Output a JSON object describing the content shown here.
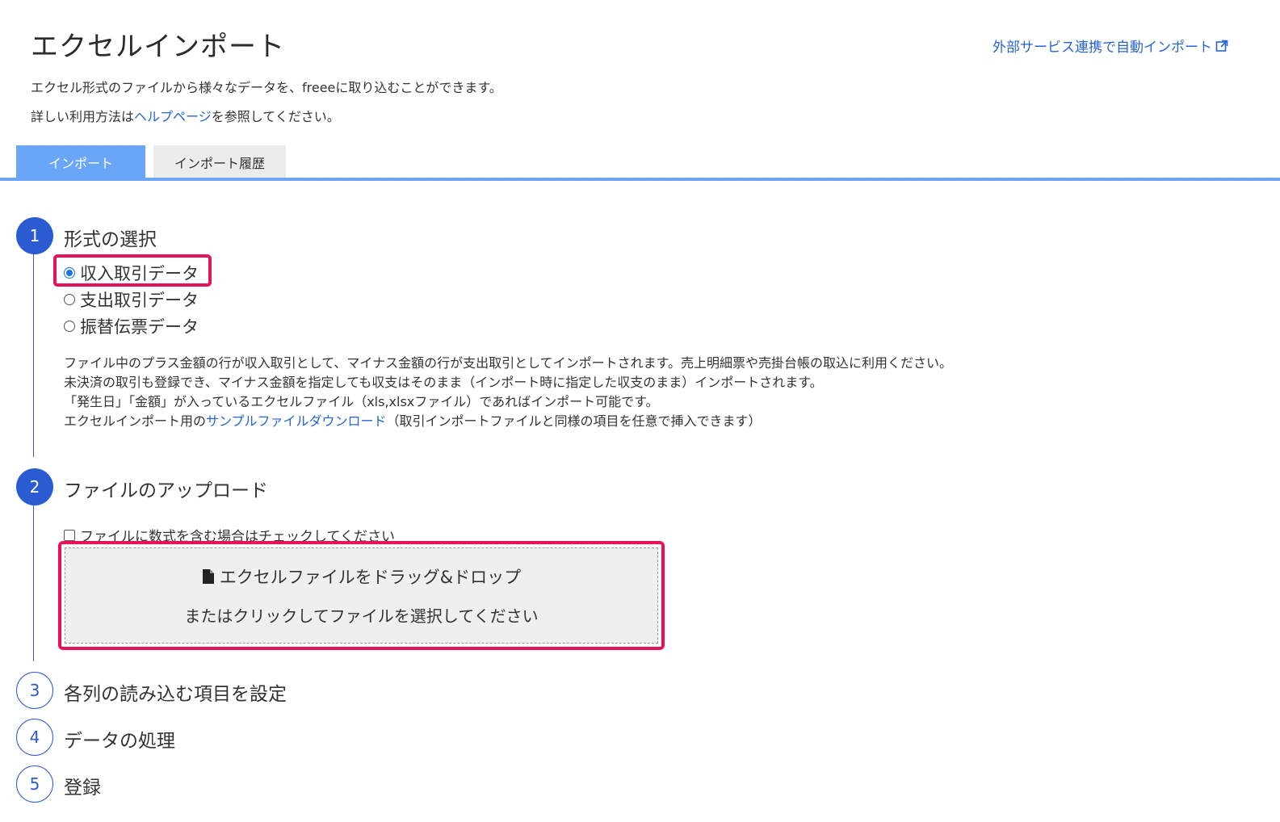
{
  "header": {
    "title": "エクセルインポート",
    "external_link": "外部サービス連携で自動インポート",
    "description_line1": "エクセル形式のファイルから様々なデータを、freeeに取り込むことができます。",
    "description_line2_prefix": "詳しい利用方法は",
    "description_line2_link": "ヘルプページ",
    "description_line2_suffix": "を参照してください。"
  },
  "tabs": [
    {
      "label": "インポート",
      "active": true
    },
    {
      "label": "インポート履歴",
      "active": false
    }
  ],
  "steps": [
    {
      "number": "1",
      "title": "形式の選択"
    },
    {
      "number": "2",
      "title": "ファイルのアップロード"
    },
    {
      "number": "3",
      "title": "各列の読み込む項目を設定"
    },
    {
      "number": "4",
      "title": "データの処理"
    },
    {
      "number": "5",
      "title": "登録"
    }
  ],
  "format_options": [
    {
      "label": "収入取引データ",
      "checked": true
    },
    {
      "label": "支出取引データ",
      "checked": false
    },
    {
      "label": "振替伝票データ",
      "checked": false
    }
  ],
  "info": {
    "line1": "ファイル中のプラス金額の行が収入取引として、マイナス金額の行が支出取引としてインポートされます。売上明細票や売掛台帳の取込に利用ください。",
    "line2": "未決済の取引も登録でき、マイナス金額を指定しても収支はそのまま（インポート時に指定した収支のまま）インポートされます。",
    "line3": "「発生日」「金額」が入っているエクセルファイル（xls,xlsxファイル）であればインポート可能です。",
    "line4_prefix": "エクセルインポート用の",
    "line4_link": "サンプルファイルダウンロード",
    "line4_suffix": "（取引インポートファイルと同様の項目を任意で挿入できます）"
  },
  "upload": {
    "formula_checkbox": "ファイルに数式を含む場合はチェックしてください",
    "dropzone_line1": "エクセルファイルをドラッグ&ドロップ",
    "dropzone_line2": "またはクリックしてファイルを選択してください"
  },
  "colors": {
    "accent": "#2a5bd0",
    "tab_active": "#6aa6f7",
    "highlight": "#e8125c",
    "link": "#2864d1"
  }
}
